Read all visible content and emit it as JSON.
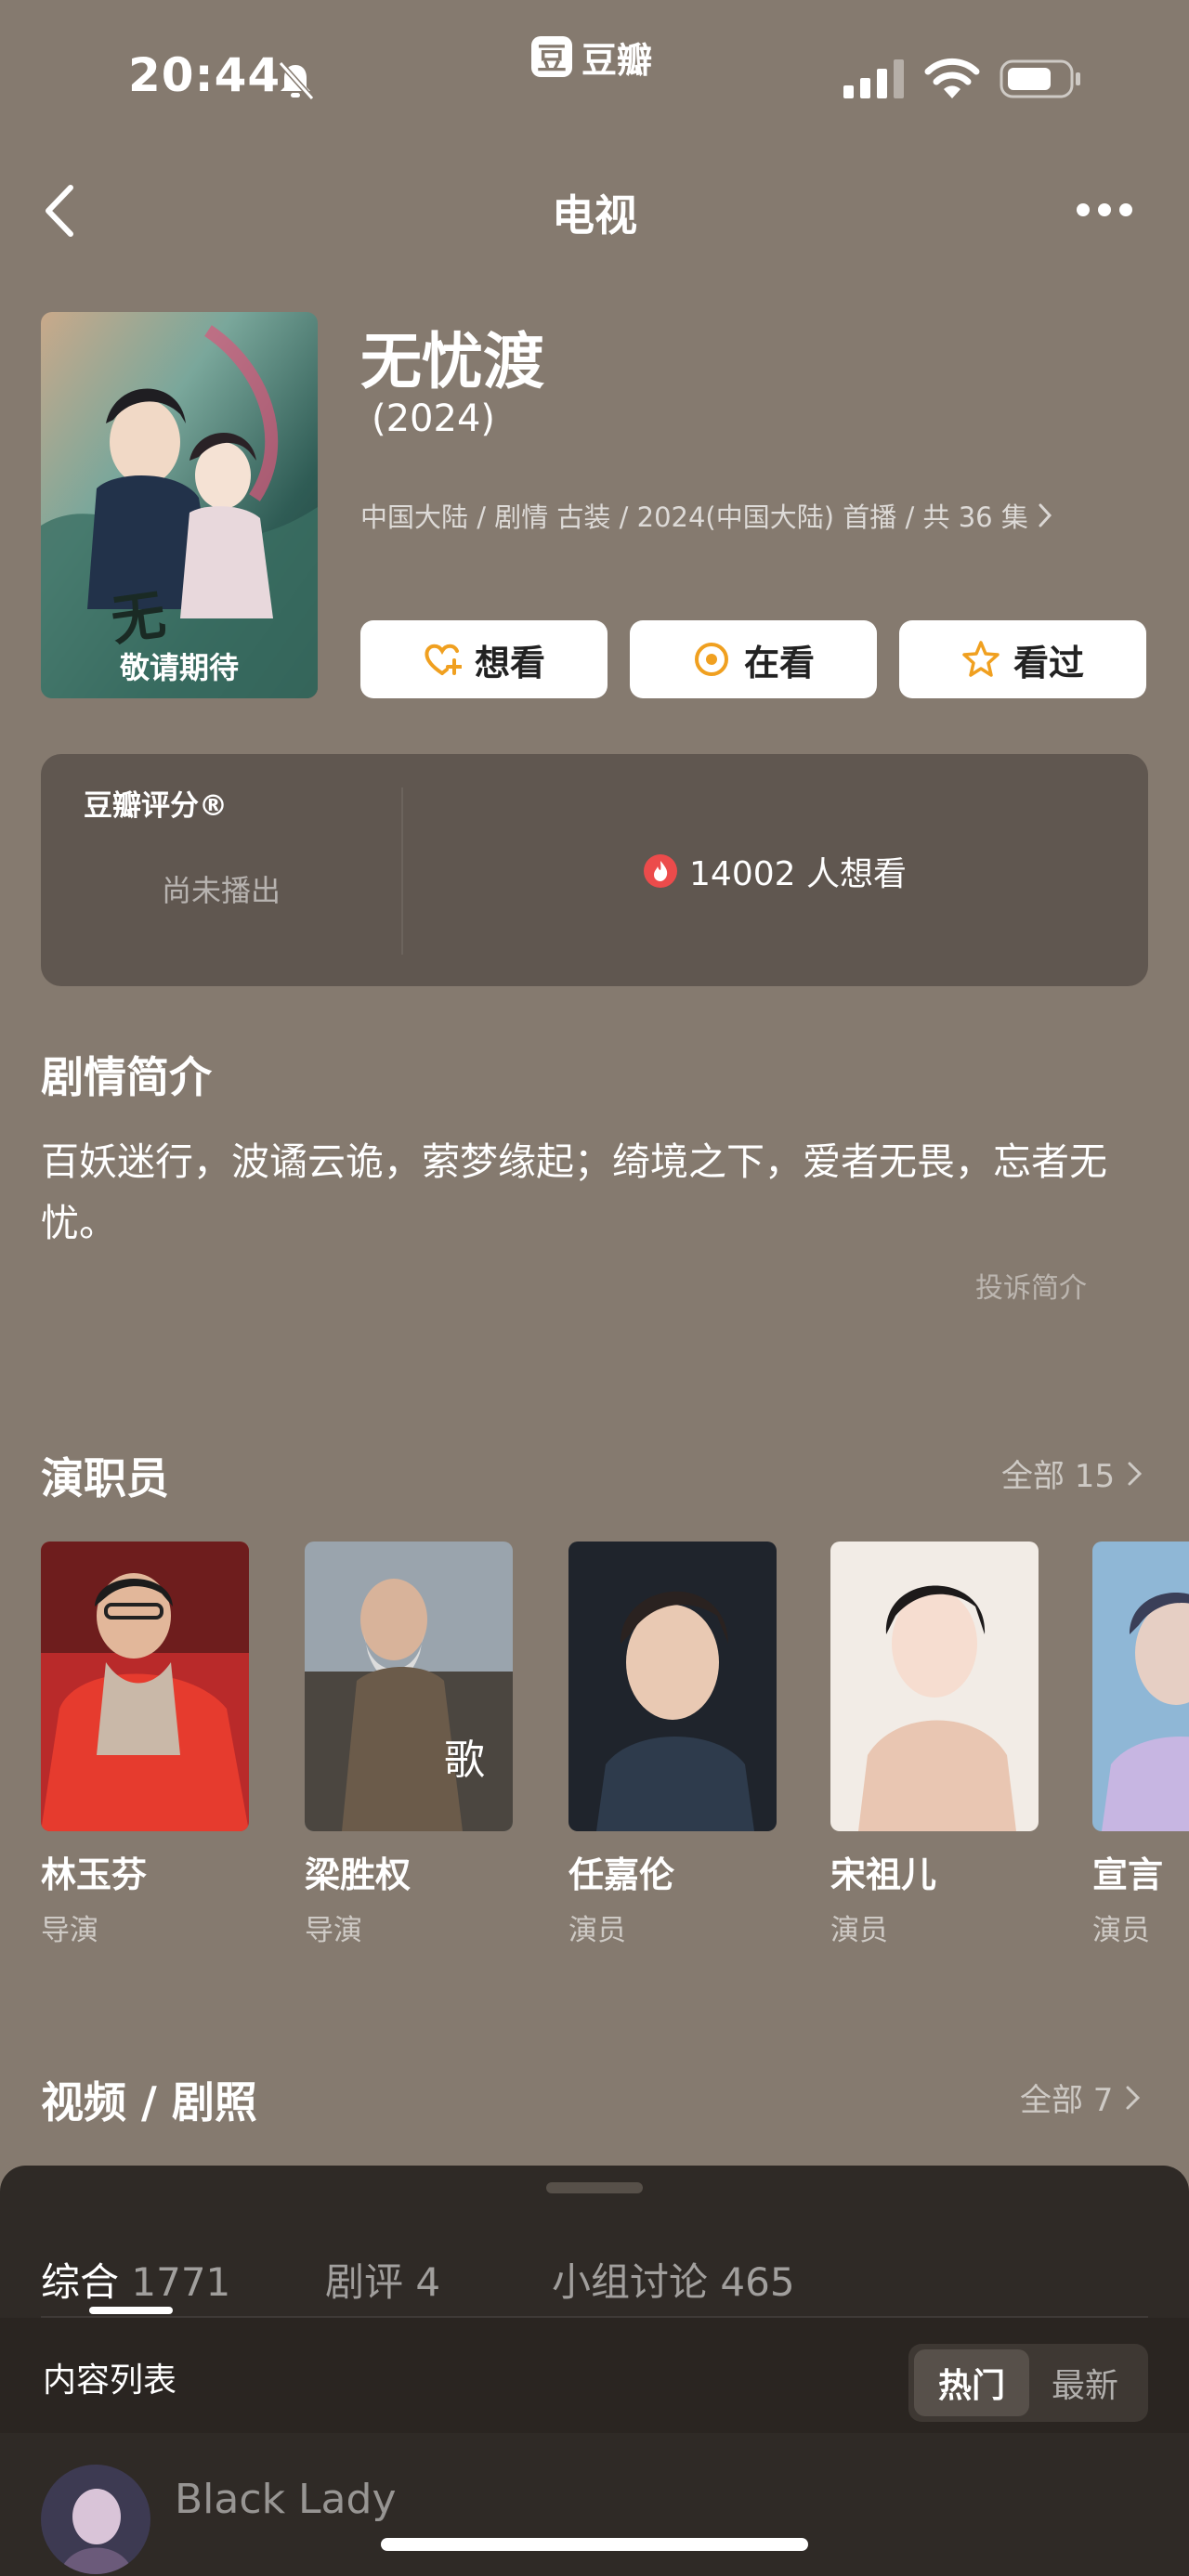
{
  "status_bar": {
    "time": "20:44",
    "app_logo_char": "豆",
    "app_name": "豆瓣"
  },
  "nav": {
    "title": "电视",
    "back_icon": "chevron-left-icon",
    "more_icon": "more-icon"
  },
  "show": {
    "title": "无忧渡",
    "year": "(2024)",
    "meta": "中国大陆 / 剧情 古装 / 2024(中国大陆) 首播 / 共 36 集",
    "poster_text": "敬请期待",
    "actions": [
      {
        "label": "想看",
        "icon": "heart-plus-icon"
      },
      {
        "label": "在看",
        "icon": "circle-dot-icon"
      },
      {
        "label": "看过",
        "icon": "star-icon"
      }
    ]
  },
  "rating": {
    "label": "豆瓣评分®",
    "status": "尚未播出",
    "wishlist": "14002 人想看",
    "accent": "#ec4b4b"
  },
  "synopsis": {
    "title": "剧情简介",
    "text": "百妖迷行，波谲云诡，萦梦缘起；绮境之下，爱者无畏，忘者无忧。",
    "report": "投诉简介"
  },
  "cast": {
    "title": "演职员",
    "all_label": "全部 15",
    "members": [
      {
        "name": "林玉芬",
        "role": "导演"
      },
      {
        "name": "梁胜权",
        "role": "导演"
      },
      {
        "name": "任嘉伦",
        "role": "演员"
      },
      {
        "name": "宋祖儿",
        "role": "演员"
      },
      {
        "name": "宣言",
        "role": "演员"
      }
    ]
  },
  "media": {
    "title": "视频 / 剧照",
    "all_label": "全部 7"
  },
  "sheet": {
    "tabs": [
      {
        "label": "综合",
        "count": "1771"
      },
      {
        "label": "剧评",
        "count": "4"
      },
      {
        "label": "小组讨论",
        "count": "465"
      }
    ],
    "list_title": "内容列表",
    "sort": {
      "hot": "热门",
      "new": "最新"
    },
    "first_item_user": "Black Lady"
  }
}
